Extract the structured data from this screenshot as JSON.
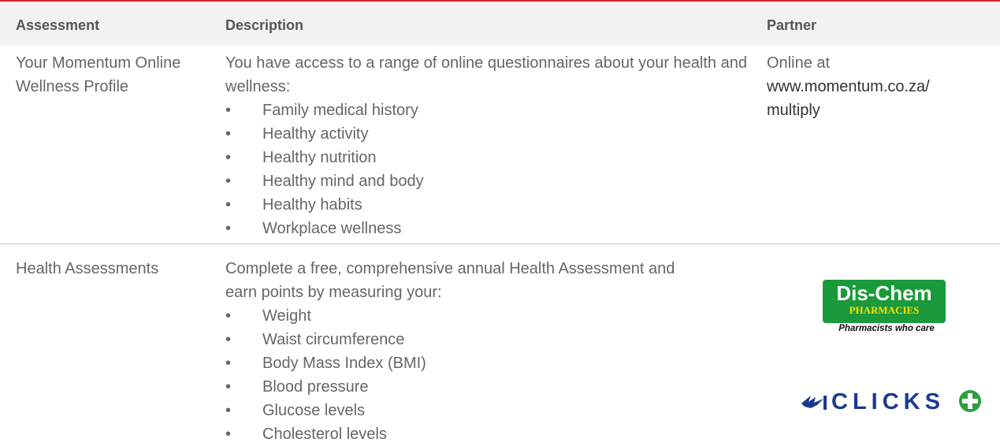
{
  "table": {
    "headers": {
      "assessment": "Assessment",
      "description": "Description",
      "partner": "Partner"
    },
    "rows": [
      {
        "assessment": "Your Momentum Online Wellness Profile",
        "description_intro": "You have access to a range of online questionnaires about your health and wellness:",
        "items": [
          "Family medical history",
          "Healthy activity",
          "Healthy nutrition",
          "Healthy mind and body",
          "Healthy habits",
          "Workplace wellness"
        ],
        "partner_prefix": "Online at",
        "partner_link_line1": "www.momentum.co.za/",
        "partner_link_line2": "multiply"
      },
      {
        "assessment": "Health Assessments",
        "description_intro": "Complete a free, comprehensive annual Health Assessment and earn points by measuring your:",
        "items": [
          "Weight",
          "Waist circumference",
          "Body Mass Index (BMI)",
          "Blood pressure",
          "Glucose levels",
          "Cholesterol levels"
        ],
        "partners": {
          "dischem_name": "Dis-Chem",
          "dischem_sub": "PHARMACIES",
          "dischem_tagline": "Pharmacists who care",
          "clicks_name": "CLICKS"
        }
      }
    ]
  },
  "colors": {
    "accent_rule": "#d9222a",
    "header_bg": "#f2f2f2",
    "dischem_green": "#1a9a3a",
    "clicks_blue": "#1b3a8f",
    "clicks_plus_green": "#2e9e3e"
  }
}
